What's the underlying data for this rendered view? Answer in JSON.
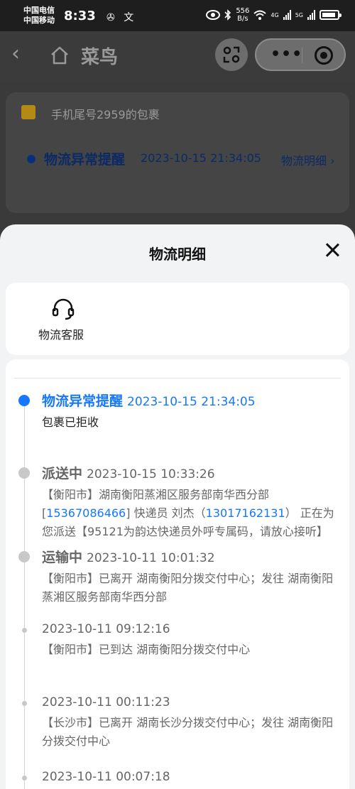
{
  "status_bar": {
    "carrier1": "中国电信",
    "carrier2": "中国移动",
    "time": "8:33",
    "speed_value": "556",
    "speed_unit": "B/s",
    "net1": "4G",
    "net2": "5G"
  },
  "app": {
    "title": "菜鸟"
  },
  "background_card": {
    "package_title": "手机尾号2959的包裹",
    "status": "物流异常提醒",
    "time": "2023-10-15 21:34:05",
    "detail_link": "物流明细 ›"
  },
  "sheet": {
    "title": "物流明细",
    "service_label": "物流客服"
  },
  "events": [
    {
      "status": "物流异常提醒",
      "time": "2023-10-15 21:34:05",
      "desc": "包裹已拒收"
    },
    {
      "status": "派送中",
      "time": "2023-10-15 10:33:26",
      "desc_a": "【衡阳市】湖南衡阳蒸湘区服务部南华西分部[",
      "phone1": "15367086466",
      "desc_b": "] 快递员 刘杰（",
      "phone2": "13017162131",
      "desc_c": "） 正在为您派送【95121为韵达快递员外呼专属码，请放心接听】"
    },
    {
      "status": "运输中",
      "time": "2023-10-11 10:01:32",
      "desc": "【衡阳市】已离开 湖南衡阳分拨交付中心；发往 湖南衡阳蒸湘区服务部南华西分部"
    },
    {
      "time": "2023-10-11 09:12:16",
      "desc": "【衡阳市】已到达 湖南衡阳分拨交付中心"
    },
    {
      "time": "2023-10-11 00:11:23",
      "desc": "【长沙市】已离开 湖南长沙分拨交付中心；发往 湖南衡阳分拨交付中心"
    },
    {
      "time": "2023-10-11 00:07:18"
    }
  ],
  "colors": {
    "accent_blue": "#1677ff",
    "muted_gray": "#666666"
  }
}
